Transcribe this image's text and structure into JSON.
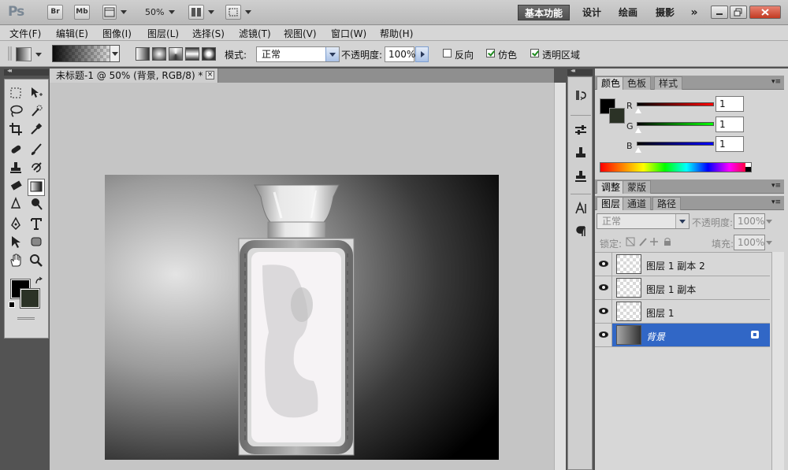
{
  "app": {
    "logo": "Ps",
    "bridge_btn": "Br",
    "minibridge_btn": "Mb",
    "zoom": "50%",
    "workspaces": [
      "基本功能",
      "设计",
      "绘画",
      "摄影"
    ],
    "more": "»"
  },
  "menu": [
    "文件(F)",
    "编辑(E)",
    "图像(I)",
    "图层(L)",
    "选择(S)",
    "滤镜(T)",
    "视图(V)",
    "窗口(W)",
    "帮助(H)"
  ],
  "options": {
    "mode_label": "模式:",
    "mode_value": "正常",
    "opacity_label": "不透明度:",
    "opacity_value": "100%",
    "reverse_label": "反向",
    "dither_label": "仿色",
    "transparency_label": "透明区域",
    "reverse_checked": false,
    "dither_checked": true,
    "transparency_checked": true
  },
  "document": {
    "tab_title": "未标题-1 @ 50% (背景, RGB/8) *",
    "close": "×"
  },
  "color_panel": {
    "tabs": [
      "颜色",
      "色板",
      "样式"
    ],
    "channels": [
      {
        "label": "R",
        "value": "1"
      },
      {
        "label": "G",
        "value": "1"
      },
      {
        "label": "B",
        "value": "1"
      }
    ],
    "fg_color": "#000000",
    "bg_color": "#2b3226"
  },
  "adjust_panel": {
    "tabs": [
      "调整",
      "蒙版"
    ]
  },
  "layers_panel": {
    "tabs": [
      "图层",
      "通道",
      "路径"
    ],
    "blend_mode": "正常",
    "opacity_label": "不透明度:",
    "opacity_value": "100%",
    "lock_label": "锁定:",
    "fill_label": "填充:",
    "fill_value": "100%",
    "layers": [
      {
        "name": "图层 1 副本 2",
        "selected": false
      },
      {
        "name": "图层 1 副本",
        "selected": false
      },
      {
        "name": "图层 1",
        "selected": false
      },
      {
        "name": "背景",
        "selected": true
      }
    ]
  },
  "colors": {
    "accent_selected": "#3167c6",
    "active_workspace": "#5a5a5a"
  }
}
